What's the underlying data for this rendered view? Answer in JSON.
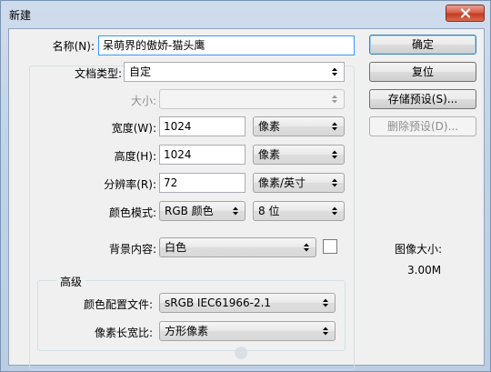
{
  "window": {
    "title": "新建"
  },
  "form": {
    "name_label": "名称(N):",
    "name_value": "呆萌界的傲娇-猫头鹰",
    "preset_label": "文档类型:",
    "preset_value": "自定",
    "size_label": "大小:",
    "size_value": "",
    "width_label": "宽度(W):",
    "width_value": "1024",
    "width_unit": "像素",
    "height_label": "高度(H):",
    "height_value": "1024",
    "height_unit": "像素",
    "resolution_label": "分辨率(R):",
    "resolution_value": "72",
    "resolution_unit": "像素/英寸",
    "color_mode_label": "颜色模式:",
    "color_mode_value": "RGB 颜色",
    "bit_depth_value": "8 位",
    "background_label": "背景内容:",
    "background_value": "白色",
    "background_swatch_color": "#ffffff"
  },
  "advanced": {
    "title": "高级",
    "color_profile_label": "颜色配置文件:",
    "color_profile_value": "sRGB IEC61966-2.1",
    "pixel_aspect_label": "像素长宽比:",
    "pixel_aspect_value": "方形像素"
  },
  "buttons": {
    "ok": "确定",
    "reset": "复位",
    "save_preset": "存储预设(S)...",
    "delete_preset": "删除预设(D)..."
  },
  "image_size": {
    "label": "图像大小:",
    "value": "3.00M"
  }
}
